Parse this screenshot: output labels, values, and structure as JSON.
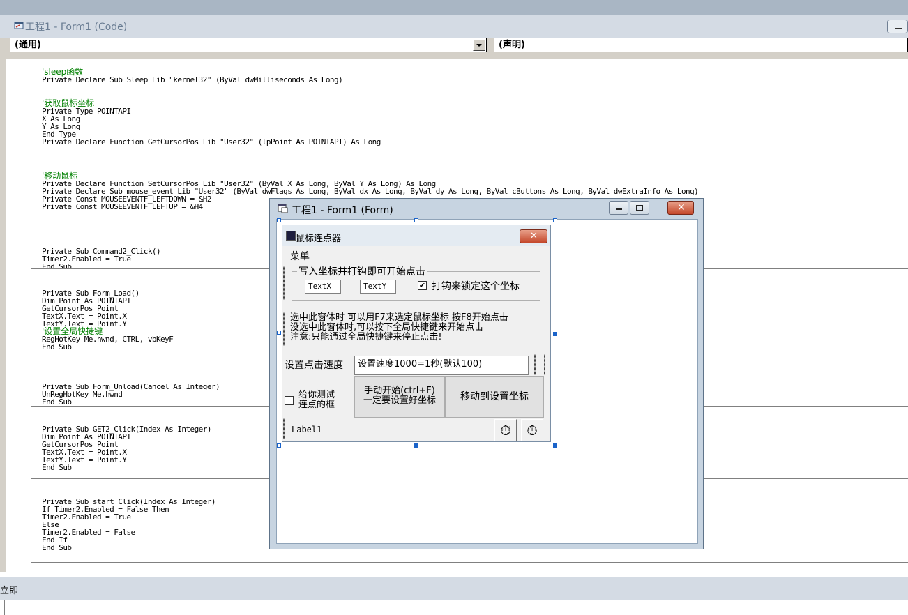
{
  "code_window": {
    "title": "工程1 - Form1 (Code)",
    "object_combo": "(通用)",
    "procedure_combo": "(声明)"
  },
  "code": {
    "block1": [
      "'sleep函数",
      "Private Declare Sub Sleep Lib \"kernel32\" (ByVal dwMilliseconds As Long)"
    ],
    "block2": [
      "'获取鼠标坐标",
      "Private Type POINTAPI",
      "X As Long",
      "Y As Long",
      "End Type",
      "Private Declare Function GetCursorPos Lib \"User32\" (lpPoint As POINTAPI) As Long"
    ],
    "block3": [
      "'移动鼠标",
      "Private Declare Function SetCursorPos Lib \"User32\" (ByVal X As Long, ByVal Y As Long) As Long",
      "Private Declare Sub mouse_event Lib \"User32\" (ByVal dwFlags As Long, ByVal dx As Long, ByVal dy As Long, ByVal cButtons As Long, ByVal dwExtraInfo As Long)",
      "Private Const MOUSEEVENTF_LEFTDOWN = &H2",
      "Private Const MOUSEEVENTF_LEFTUP = &H4"
    ],
    "block4": [
      "Private Sub Command2_Click()",
      "Timer2.Enabled = True",
      "End Sub"
    ],
    "block5": [
      "Private Sub Form_Load()",
      "Dim Point As POINTAPI",
      "GetCursorPos Point",
      "TextX.Text = Point.X",
      "TextY.Text = Point.Y",
      "'设置全局快捷键",
      "RegHotKey Me.hwnd, CTRL, vbKeyF",
      "End Sub"
    ],
    "block6": [
      "Private Sub Form_Unload(Cancel As Integer)",
      "UnRegHotKey Me.hwnd",
      "End Sub"
    ],
    "block7": [
      "Private Sub GET2_Click(Index As Integer)",
      "Dim Point As POINTAPI",
      "GetCursorPos Point",
      "TextX.Text = Point.X",
      "TextY.Text = Point.Y",
      "End Sub"
    ],
    "block8": [
      "Private Sub start_Click(Index As Integer)",
      "If Timer2.Enabled = False Then",
      "Timer2.Enabled = True",
      "Else",
      "Timer2.Enabled = False",
      "End If",
      "End Sub"
    ]
  },
  "form_window": {
    "title": "工程1 - Form1 (Form)"
  },
  "designed_form": {
    "title": "鼠标连点器",
    "menu": "菜单",
    "frame_caption": "写入坐标并打钩即可开始点击",
    "textx": "TextX",
    "texty": "TextY",
    "lock_checkbox": "打钩来锁定这个坐标",
    "lock_checked": "✔",
    "info_line1": "选中此窗体时 可以用F7来选定鼠标坐标 按F8开始点击",
    "info_line2": "没选中此窗体时,可以按下全局快捷键来开始点击",
    "info_line3": "注意:只能通过全局快捷键来停止点击!",
    "speed_label": "设置点击速度",
    "speed_value": "设置速度1000=1秒(默认100)",
    "test_checkbox_line1": "给你测试",
    "test_checkbox_line2": "连点的框",
    "manual_button_line1": "手动开始(ctrl+F)",
    "manual_button_line2": "一定要设置好坐标",
    "move_button": "移动到设置坐标",
    "label1": "Label1",
    "timer_icon": "⏱"
  },
  "immediate": {
    "title": "立即"
  }
}
